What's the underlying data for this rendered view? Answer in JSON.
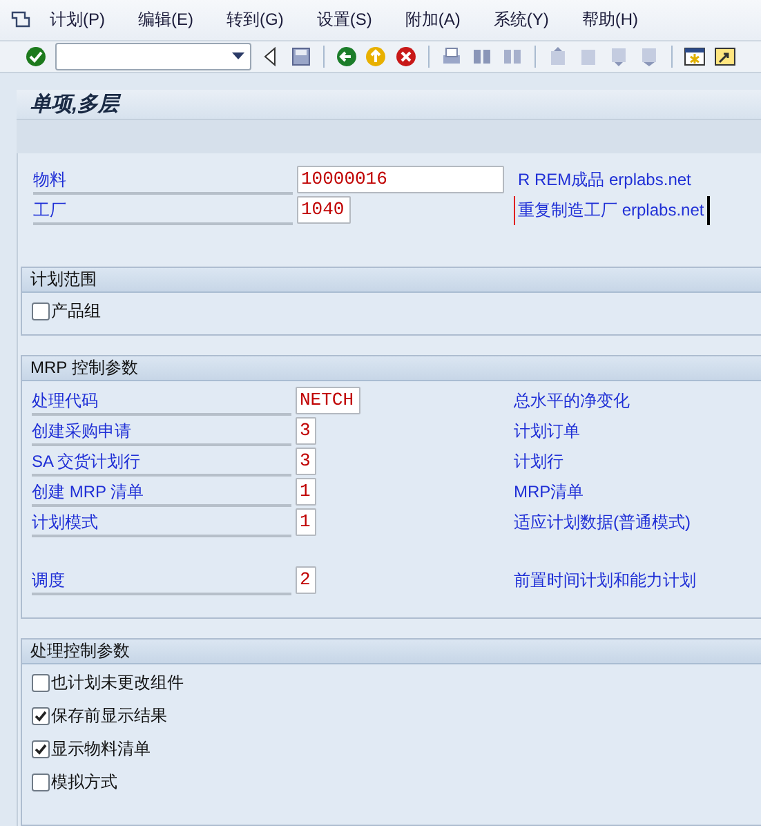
{
  "menu": [
    {
      "label": "计划(P)"
    },
    {
      "label": "编辑(E)"
    },
    {
      "label": "转到(G)"
    },
    {
      "label": "设置(S)"
    },
    {
      "label": "附加(A)"
    },
    {
      "label": "系统(Y)"
    },
    {
      "label": "帮助(H)"
    }
  ],
  "title": "单项,多层",
  "header_fields": [
    {
      "label": "物料",
      "value": "10000016",
      "description": "R REM成品 erplabs.net",
      "focused": false
    },
    {
      "label": "工厂",
      "value": "1040",
      "description": "重复制造工厂 erplabs.net",
      "focused": true
    }
  ],
  "sections": [
    {
      "title": "计划范围",
      "kind": "checkboxes",
      "items": [
        {
          "label": "产品组",
          "checked": false
        }
      ]
    },
    {
      "title": "MRP 控制参数",
      "kind": "params",
      "groups": [
        [
          {
            "label": "处理代码",
            "value": "NETCH",
            "description": "总水平的净变化"
          },
          {
            "label": "创建采购申请",
            "value": "3",
            "description": "计划订单"
          },
          {
            "label": "SA 交货计划行",
            "value": "3",
            "description": "计划行"
          },
          {
            "label": "创建 MRP 清单",
            "value": "1",
            "description": "MRP清单"
          },
          {
            "label": "计划模式",
            "value": "1",
            "description": "适应计划数据(普通模式)"
          }
        ],
        [
          {
            "label": "调度",
            "value": "2",
            "description": "前置时间计划和能力计划"
          }
        ]
      ]
    },
    {
      "title": "处理控制参数",
      "kind": "checkboxes",
      "items": [
        {
          "label": "也计划未更改组件",
          "checked": false
        },
        {
          "label": "保存前显示结果",
          "checked": true
        },
        {
          "label": "显示物料清单",
          "checked": true
        },
        {
          "label": "模拟方式",
          "checked": false
        }
      ]
    }
  ]
}
